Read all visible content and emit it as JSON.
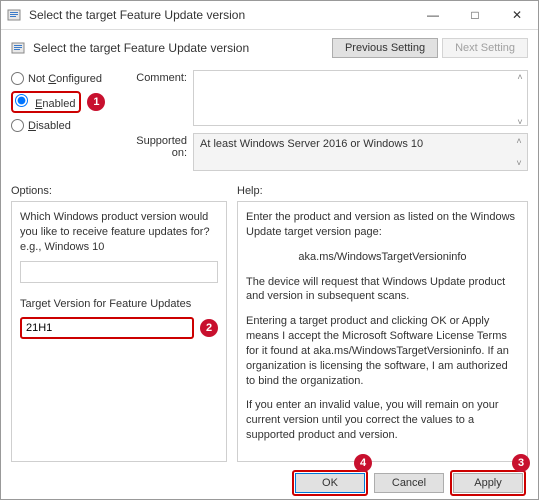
{
  "window": {
    "title": "Select the target Feature Update version"
  },
  "header": {
    "title": "Select the target Feature Update version",
    "prev": "Previous Setting",
    "next": "Next Setting"
  },
  "radios": {
    "not_configured": "Not Configured",
    "enabled": "Enabled",
    "disabled": "Disabled"
  },
  "fields": {
    "comment_label": "Comment:",
    "comment_value": "",
    "supported_label": "Supported on:",
    "supported_value": "At least Windows Server 2016 or Windows 10"
  },
  "labels": {
    "options": "Options:",
    "help": "Help:"
  },
  "options": {
    "q1": "Which Windows product version would you like to receive feature updates for? e.g., Windows 10",
    "q1_value": "",
    "q2": "Target Version for Feature Updates",
    "q2_value": "21H1"
  },
  "help": {
    "p1": "Enter the product and version as listed on the Windows Update target version page:",
    "p2": "aka.ms/WindowsTargetVersioninfo",
    "p3": "The device will request that Windows Update product and version in subsequent scans.",
    "p4": "Entering a target product and clicking OK or Apply means I accept the Microsoft Software License Terms for it found at aka.ms/WindowsTargetVersioninfo. If an organization is licensing the software, I am authorized to bind the organization.",
    "p5": "If you enter an invalid value, you will remain on your current version until you correct the values to a supported product and version."
  },
  "footer": {
    "ok": "OK",
    "cancel": "Cancel",
    "apply": "Apply"
  },
  "callouts": {
    "c1": "1",
    "c2": "2",
    "c3": "3",
    "c4": "4"
  }
}
